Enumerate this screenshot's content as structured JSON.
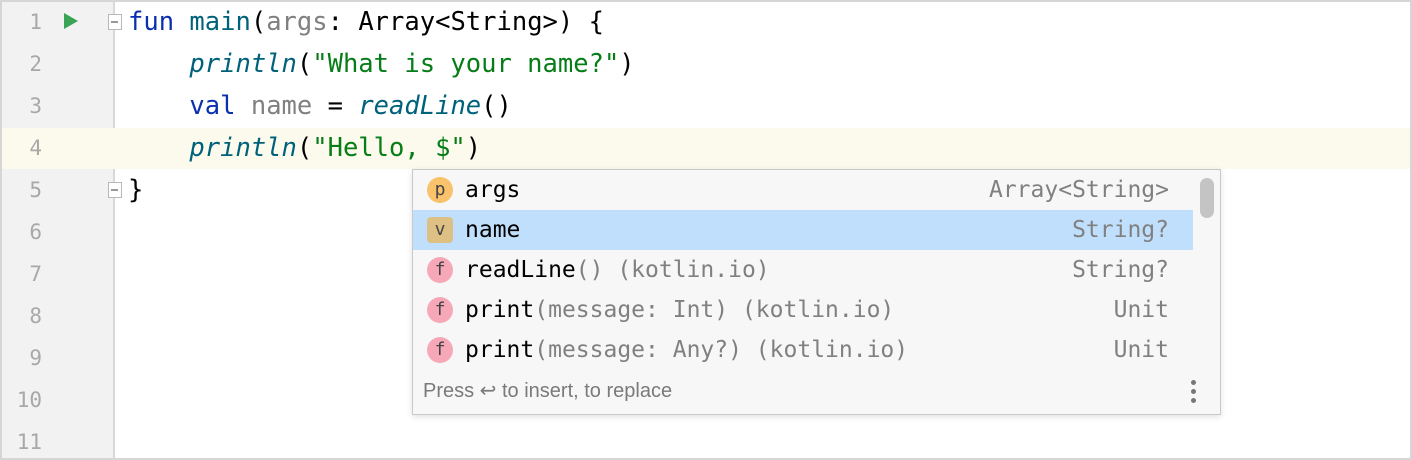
{
  "editor": {
    "current_line": 4,
    "line_numbers": [
      "1",
      "2",
      "3",
      "4",
      "5",
      "6",
      "7",
      "8",
      "9",
      "10",
      "11"
    ],
    "lines": [
      [
        {
          "t": "fun ",
          "k": "kw"
        },
        {
          "t": "main",
          "k": "fn"
        },
        {
          "t": "(",
          "k": "pl"
        },
        {
          "t": "args",
          "k": "param"
        },
        {
          "t": ": Array<String>) {",
          "k": "pl"
        }
      ],
      [
        {
          "t": "    ",
          "k": "pl"
        },
        {
          "t": "println",
          "k": "it"
        },
        {
          "t": "(",
          "k": "pl"
        },
        {
          "t": "\"What is your name?\"",
          "k": "str"
        },
        {
          "t": ")",
          "k": "pl"
        }
      ],
      [
        {
          "t": "    ",
          "k": "pl"
        },
        {
          "t": "val ",
          "k": "kw"
        },
        {
          "t": "name",
          "k": "var"
        },
        {
          "t": " = ",
          "k": "pl"
        },
        {
          "t": "readLine",
          "k": "it"
        },
        {
          "t": "()",
          "k": "pl"
        }
      ],
      [
        {
          "t": "    ",
          "k": "pl"
        },
        {
          "t": "println",
          "k": "it"
        },
        {
          "t": "(",
          "k": "pl"
        },
        {
          "t": "\"Hello, $\"",
          "k": "str"
        },
        {
          "t": ")",
          "k": "pl"
        }
      ],
      [
        {
          "t": "}",
          "k": "pl"
        }
      ]
    ]
  },
  "completion": {
    "items": [
      {
        "icon": "p",
        "name": "args",
        "tail": "",
        "type": "Array<String>"
      },
      {
        "icon": "v",
        "name": "name",
        "tail": "",
        "type": "String?",
        "selected": true
      },
      {
        "icon": "f",
        "name": "readLine",
        "tail": "() (kotlin.io)",
        "type": "String?"
      },
      {
        "icon": "f",
        "name": "print",
        "tail": "(message: Int) (kotlin.io)",
        "type": "Unit"
      },
      {
        "icon": "f",
        "name": "print",
        "tail": "(message: Any?) (kotlin.io)",
        "type": "Unit"
      }
    ],
    "footer": "Press ↩ to insert,  to replace"
  }
}
